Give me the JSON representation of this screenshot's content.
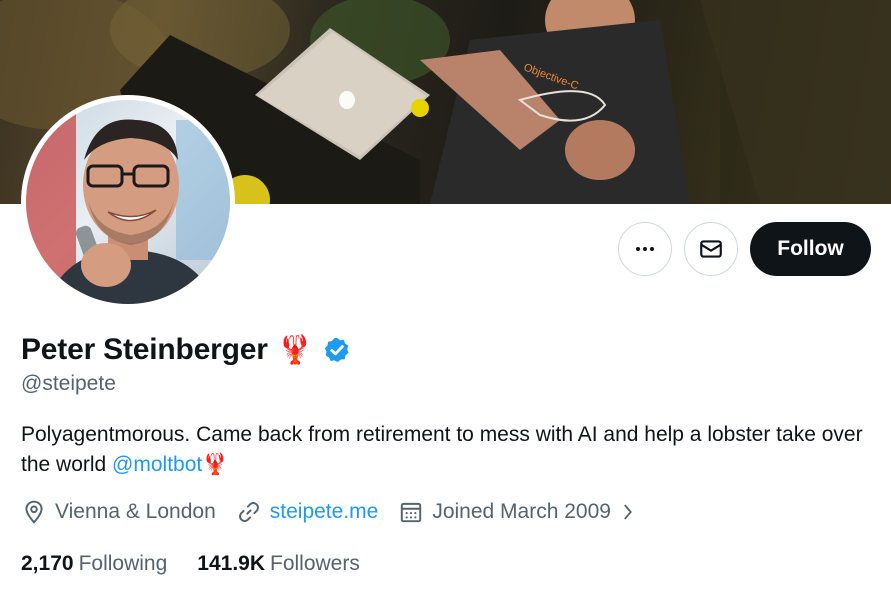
{
  "profile": {
    "display_name": "Peter Steinberger",
    "name_emoji": "🦞",
    "handle": "@steipete",
    "bio_text": "Polyagentmorous. Came back from retirement to mess with AI and help a lobster take over the world ",
    "bio_mention": "@moltbot",
    "bio_emoji": "🦞",
    "location": "Vienna & London",
    "website": "steipete.me",
    "joined": "Joined March 2009",
    "following_count": "2,170",
    "following_label": "Following",
    "followers_count": "141.9K",
    "followers_label": "Followers"
  },
  "actions": {
    "follow_label": "Follow",
    "more_icon": "more-horizontal-icon",
    "message_icon": "envelope-icon"
  },
  "banner": {
    "shirt_text": "Objective-C"
  },
  "colors": {
    "text_primary": "#0f1419",
    "text_secondary": "#536471",
    "link": "#1d9bf0",
    "verified": "#1d9bf0",
    "follow_bg": "#0f1419",
    "border": "#cfd9de"
  },
  "icons": [
    "location-pin-icon",
    "link-icon",
    "calendar-icon",
    "chevron-right-icon",
    "verified-badge-icon"
  ]
}
